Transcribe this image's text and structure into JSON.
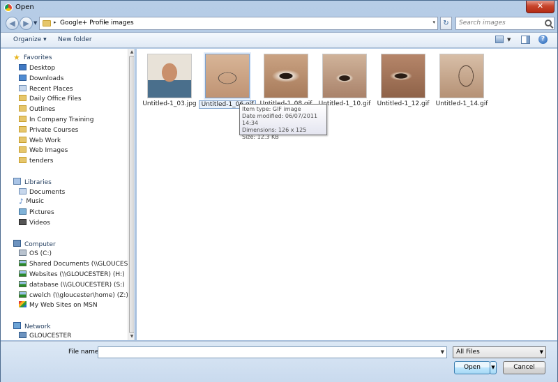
{
  "window": {
    "title": "Open",
    "close_glyph": "✕"
  },
  "nav_buttons": {
    "back_glyph": "◀",
    "forward_glyph": "▶",
    "dropdown_glyph": "▼"
  },
  "address": {
    "crumbs": [
      "Google+ Profile",
      "images"
    ],
    "arrow_glyph": "▸",
    "dropdown_glyph": "▾",
    "refresh_glyph": "↻"
  },
  "search": {
    "placeholder": "Search images"
  },
  "toolbar": {
    "organize_label": "Organize ▾",
    "new_folder_label": "New folder",
    "views_dd_glyph": "▼",
    "help_glyph": "?"
  },
  "sidebar": {
    "favorites": {
      "label": "Favorites",
      "icon": "★",
      "items": [
        "Desktop",
        "Downloads",
        "Recent Places",
        "Daily Office Files",
        "Outlines",
        "In Company Training",
        "Private Courses",
        "Web Work",
        "Web Images",
        "tenders"
      ]
    },
    "libraries": {
      "label": "Libraries",
      "items": [
        "Documents",
        "Music",
        "Pictures",
        "Videos"
      ]
    },
    "computer": {
      "label": "Computer",
      "items": [
        "OS (C:)",
        "Shared Documents (\\\\GLOUCESTER) (",
        "Websites (\\\\GLOUCESTER) (H:)",
        "database (\\\\GLOUCESTER) (S:)",
        "cwelch (\\\\gloucester\\home) (Z:)",
        "My Web Sites on MSN"
      ]
    },
    "network": {
      "label": "Network",
      "items": [
        "GLOUCESTER"
      ]
    },
    "music_glyph": "♪",
    "scroll_up_glyph": "▲",
    "scroll_down_glyph": "▼"
  },
  "files": [
    {
      "name": "Untitled-1_03.jpg",
      "thumb": "face"
    },
    {
      "name": "Untitled-1_06.gif",
      "thumb": "glasses",
      "selected": true
    },
    {
      "name": "Untitled-1_08.gif",
      "thumb": "eye"
    },
    {
      "name": "Untitled-1_10.gif",
      "thumb": "eyeglass"
    },
    {
      "name": "Untitled-1_12.gif",
      "thumb": "eye2"
    },
    {
      "name": "Untitled-1_14.gif",
      "thumb": "rim"
    }
  ],
  "tooltip": {
    "type": "Item type: GIF image",
    "modified": "Date modified: 06/07/2011 14:34",
    "dimensions": "Dimensions: 126 x 125",
    "size": "Size: 12.3 KB"
  },
  "footer": {
    "file_name_label": "File name:",
    "file_name_value": "",
    "file_type": "All Files",
    "open_label": "Open",
    "cancel_label": "Cancel",
    "dropdown_glyph": "▼"
  },
  "colors": {
    "accent": "#3c7fb1",
    "selection": "#7da2ce",
    "close": "#c7452c"
  }
}
